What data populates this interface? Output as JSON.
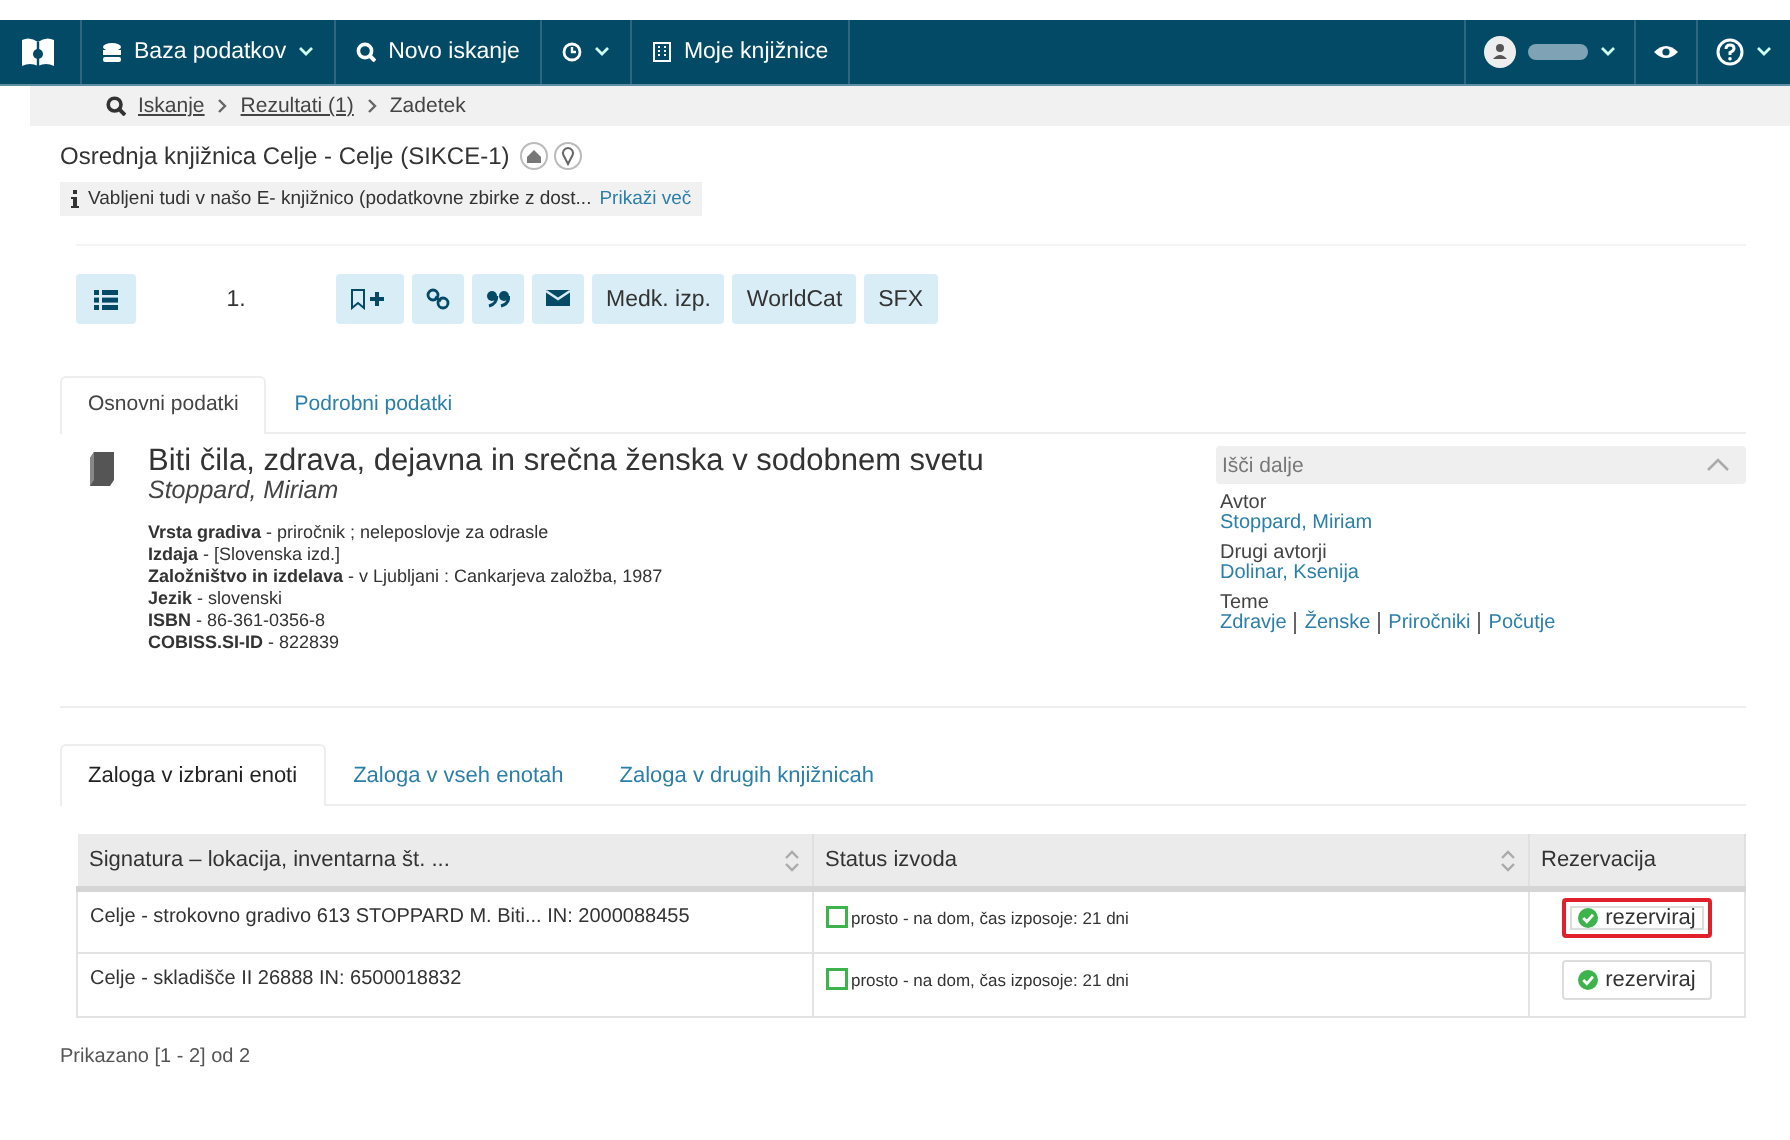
{
  "navbar": {
    "menus": [
      {
        "kind": "logo"
      },
      {
        "kind": "menu",
        "label": "Baza podatkov",
        "dropdown": true
      },
      {
        "kind": "menu",
        "label": "Novo iskanje",
        "dropdown": false
      },
      {
        "kind": "menu",
        "dropdown": true
      },
      {
        "kind": "menu",
        "label": "Moje knjižnice",
        "dropdown": false
      }
    ],
    "right": [
      {
        "kind": "user",
        "dropdown": true
      },
      {
        "kind": "eye",
        "dropdown": false
      },
      {
        "kind": "help",
        "dropdown": true
      }
    ]
  },
  "breadcrumb": [
    {
      "label": "Iskanje",
      "link": true
    },
    {
      "label": "Rezultati (1)",
      "link": true
    },
    {
      "label": "Zadetek",
      "link": false
    }
  ],
  "library": {
    "title": "Osrednja knjižnica Celje - Celje (SIKCE-1)"
  },
  "notice": {
    "text": "Vabljeni tudi v našo E- knjižnico (podatkovne zbirke z dost...",
    "link": "Prikaži več"
  },
  "toolbar": {
    "number": "1.",
    "buttons": [
      {
        "kind": "icon"
      },
      {
        "kind": "icon"
      },
      {
        "kind": "icon"
      },
      {
        "kind": "icon"
      },
      {
        "kind": "text",
        "label": "Medk. izp."
      },
      {
        "kind": "text",
        "label": "WorldCat"
      },
      {
        "kind": "text",
        "label": "SFX"
      }
    ]
  },
  "record_tabs": [
    {
      "label": "Osnovni podatki",
      "selected": true
    },
    {
      "label": "Podrobni podatki",
      "selected": false
    }
  ],
  "record": {
    "title": "Biti čila, zdrava, dejavna in srečna ženska v sodobnem svetu",
    "author": "Stoppard, Miriam",
    "fields": [
      "**Vrsta gradiva** - priročnik ; neleposlovje za odrasle",
      "**Izdaja** - [Slovenska izd.]",
      "**Založništvo in izdelava** - v Ljubljani : Cankarjeva založba, 1987",
      "**Jezik** - slovenski",
      "**ISBN** - 86-361-0356-8",
      "**COBISS.SI-ID** - 822839"
    ]
  },
  "search_further": {
    "title": "Išči dalje",
    "expanded": true,
    "groups": [
      {
        "label": "Avtor",
        "links": [
          "Stoppard, Miriam"
        ]
      },
      {
        "label": "Drugi avtorji",
        "links": [
          "Dolinar, Ksenija"
        ]
      },
      {
        "label": "Teme",
        "links": [
          "Zdravje",
          "Ženske",
          "Priročniki",
          "Počutje"
        ]
      }
    ]
  },
  "stock_tabs": [
    {
      "label": "Zaloga v izbrani enoti",
      "selected": true
    },
    {
      "label": "Zaloga v vseh enotah",
      "selected": false
    },
    {
      "label": "Zaloga v drugih knjižnicah",
      "selected": false
    }
  ],
  "table": {
    "columns": [
      {
        "label": "Signatura – lokacija, inventarna št. ...",
        "sortable": true
      },
      {
        "label": "Status izvoda",
        "sortable": true
      },
      {
        "label": "Rezervacija",
        "sortable": false
      }
    ],
    "rows": [
      {
        "signature": "Celje - strokovno gradivo 613 STOPPARD M. Biti... IN: 2000088455",
        "status": "prosto - na dom, čas izposoje: 21 dni",
        "action": "rezerviraj",
        "highlighted": true
      },
      {
        "signature": "Celje - skladišče II 26888 IN: 6500018832",
        "status": "prosto - na dom, čas izposoje: 21 dni",
        "action": "rezerviraj",
        "highlighted": false
      }
    ]
  },
  "footer": "Prikazano [1 - 2] od 2"
}
